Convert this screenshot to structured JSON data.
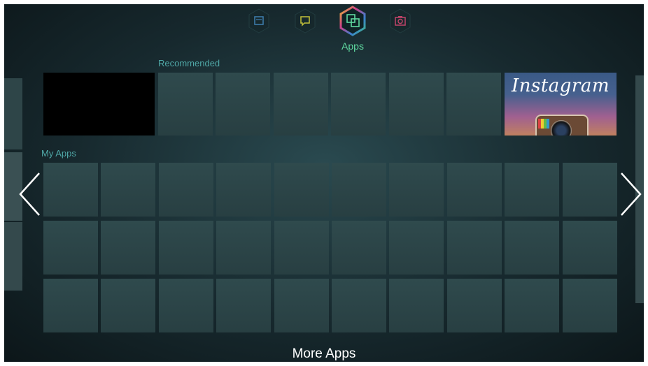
{
  "nav": {
    "items": [
      {
        "icon": "document-icon",
        "color": "#3f7fb0"
      },
      {
        "icon": "chat-icon",
        "color": "#c4c13a"
      },
      {
        "icon": "apps-icon",
        "color": "#5fd9a0",
        "selected": true
      },
      {
        "icon": "camera-icon",
        "color": "#c0446a"
      }
    ],
    "selected_label": "Apps"
  },
  "recommended": {
    "label": "Recommended",
    "tiles": [
      "",
      "",
      "",
      "",
      "",
      "",
      "",
      "Instagram"
    ]
  },
  "my_apps": {
    "label": "My Apps",
    "rows": 3,
    "cols": 10
  },
  "footer": {
    "more_apps_label": "More Apps"
  },
  "colors": {
    "tile": "#2f4a4d",
    "accent": "#5fd9a0",
    "section_label": "#4fa7a6"
  }
}
